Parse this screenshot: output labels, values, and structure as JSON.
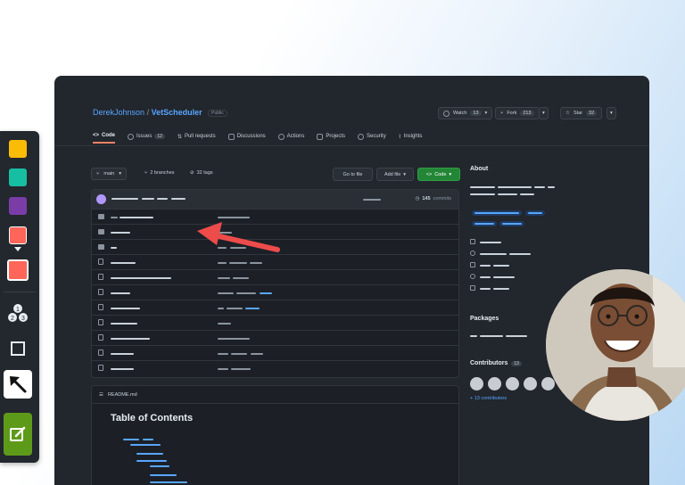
{
  "repo": {
    "owner": "DerekJohnson",
    "separator": "/",
    "name": "VetScheduler",
    "visibility": "Public"
  },
  "header_actions": {
    "watch_label": "Watch",
    "watch_count": "13",
    "fork_label": "Fork",
    "fork_count": "213",
    "star_label": "Star",
    "star_count": "32"
  },
  "tabs": [
    {
      "label": "Code",
      "icon": "code-icon",
      "active": true
    },
    {
      "label": "Issues",
      "icon": "issue-icon",
      "count": "12"
    },
    {
      "label": "Pull requests",
      "icon": "pull-request-icon"
    },
    {
      "label": "Discussions",
      "icon": "discussion-icon"
    },
    {
      "label": "Actions",
      "icon": "play-icon"
    },
    {
      "label": "Projects",
      "icon": "table-icon"
    },
    {
      "label": "Security",
      "icon": "shield-icon"
    },
    {
      "label": "Insights",
      "icon": "graph-icon"
    }
  ],
  "toolbar": {
    "branch": "main",
    "branches": "2 branches",
    "tags": "32 tags",
    "go_to_file": "Go to file",
    "add_file": "Add file",
    "code": "Code"
  },
  "commits": {
    "count": "145",
    "label": "commits"
  },
  "readme": {
    "filename": "README.md",
    "heading": "Table of Contents"
  },
  "sidebar": {
    "about": "About",
    "packages": "Packages",
    "contributors": "Contributors",
    "contributors_count": "13",
    "more_contributors": "+ 13 contributors"
  },
  "colors": {
    "swatches": [
      "#fbbc05",
      "#16bfa2",
      "#7a3da8",
      "#ff6559",
      "#ff6559"
    ],
    "annotation_arrow": "#ee4b4b",
    "code_button": "#238636",
    "draw_tool": "#5e9a1a"
  },
  "tool_icons": [
    "numbered-steps-icon",
    "rectangle-icon",
    "arrow-icon",
    "edit-icon"
  ]
}
